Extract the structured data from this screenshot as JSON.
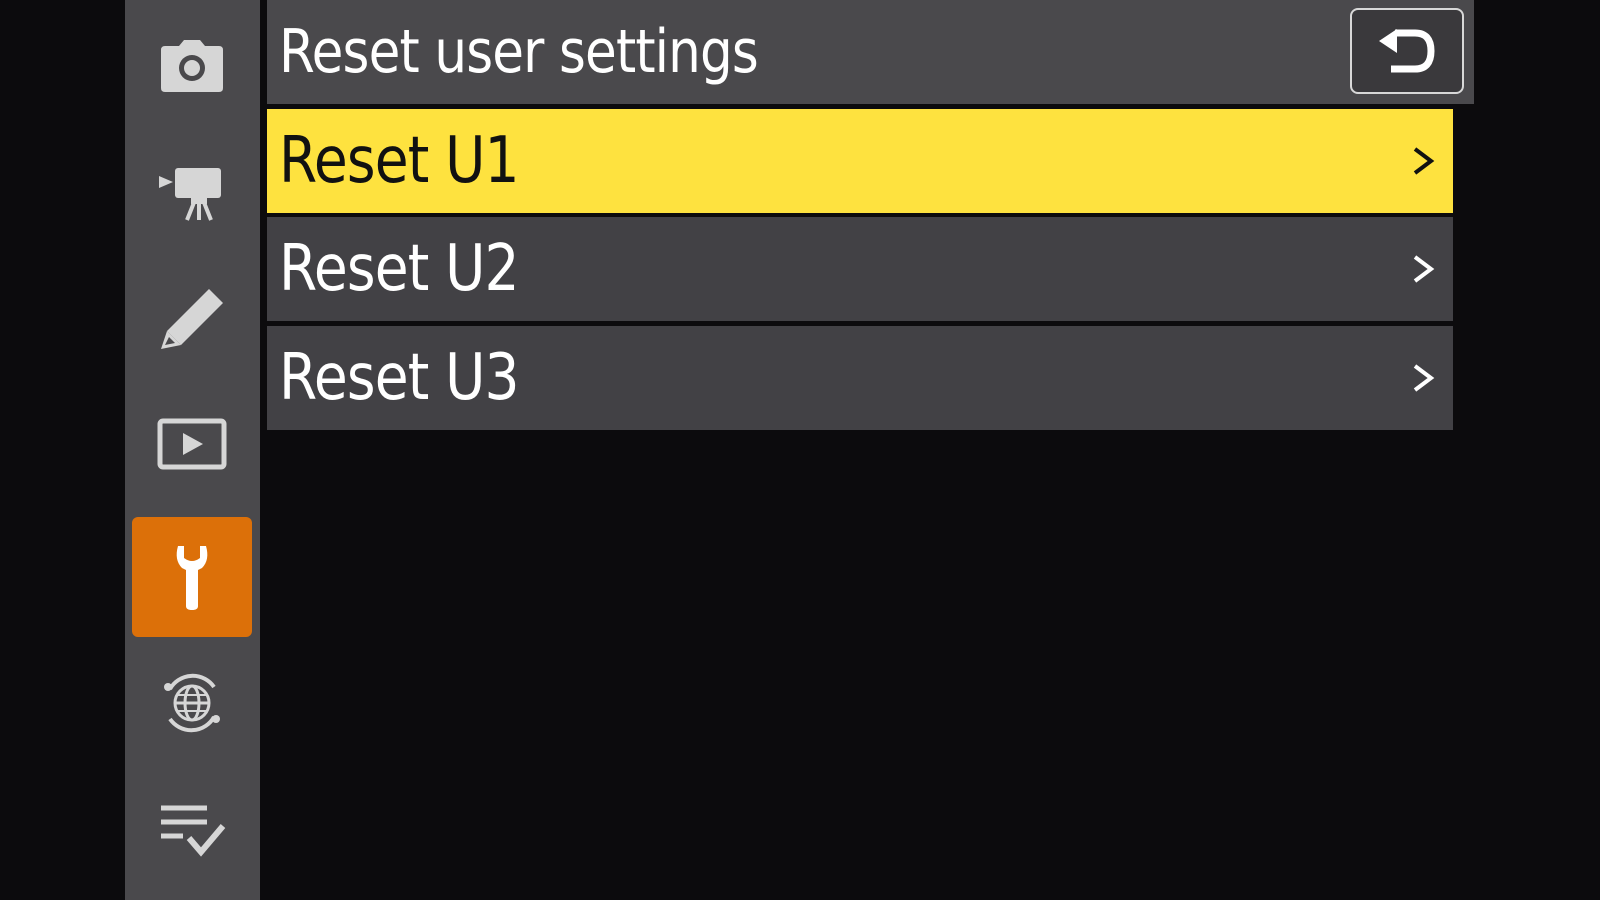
{
  "header": {
    "title": "Reset user settings"
  },
  "sidebar": {
    "tabs": [
      {
        "icon": "photo-shooting-camera-icon",
        "active": false
      },
      {
        "icon": "video-recording-camera-icon",
        "active": false
      },
      {
        "icon": "custom-settings-pencil-icon",
        "active": false
      },
      {
        "icon": "playback-icon",
        "active": false
      },
      {
        "icon": "setup-wrench-icon",
        "active": true
      },
      {
        "icon": "network-globe-icon",
        "active": false
      },
      {
        "icon": "my-menu-icon",
        "active": false
      }
    ]
  },
  "back_button": {
    "icon": "return-arrow-icon"
  },
  "menu": {
    "items": [
      {
        "label": "Reset U1",
        "selected": true,
        "icon": "chevron-right-icon"
      },
      {
        "label": "Reset U2",
        "selected": false,
        "icon": "chevron-right-icon"
      },
      {
        "label": "Reset U3",
        "selected": false,
        "icon": "chevron-right-icon"
      }
    ]
  },
  "colors": {
    "background": "#0c0b0d",
    "panel": "#4a494c",
    "row": "#424145",
    "selected_row": "#fee23f",
    "active_tab": "#dc7009",
    "icon": "#d6d6d6",
    "text": "#ffffff"
  }
}
